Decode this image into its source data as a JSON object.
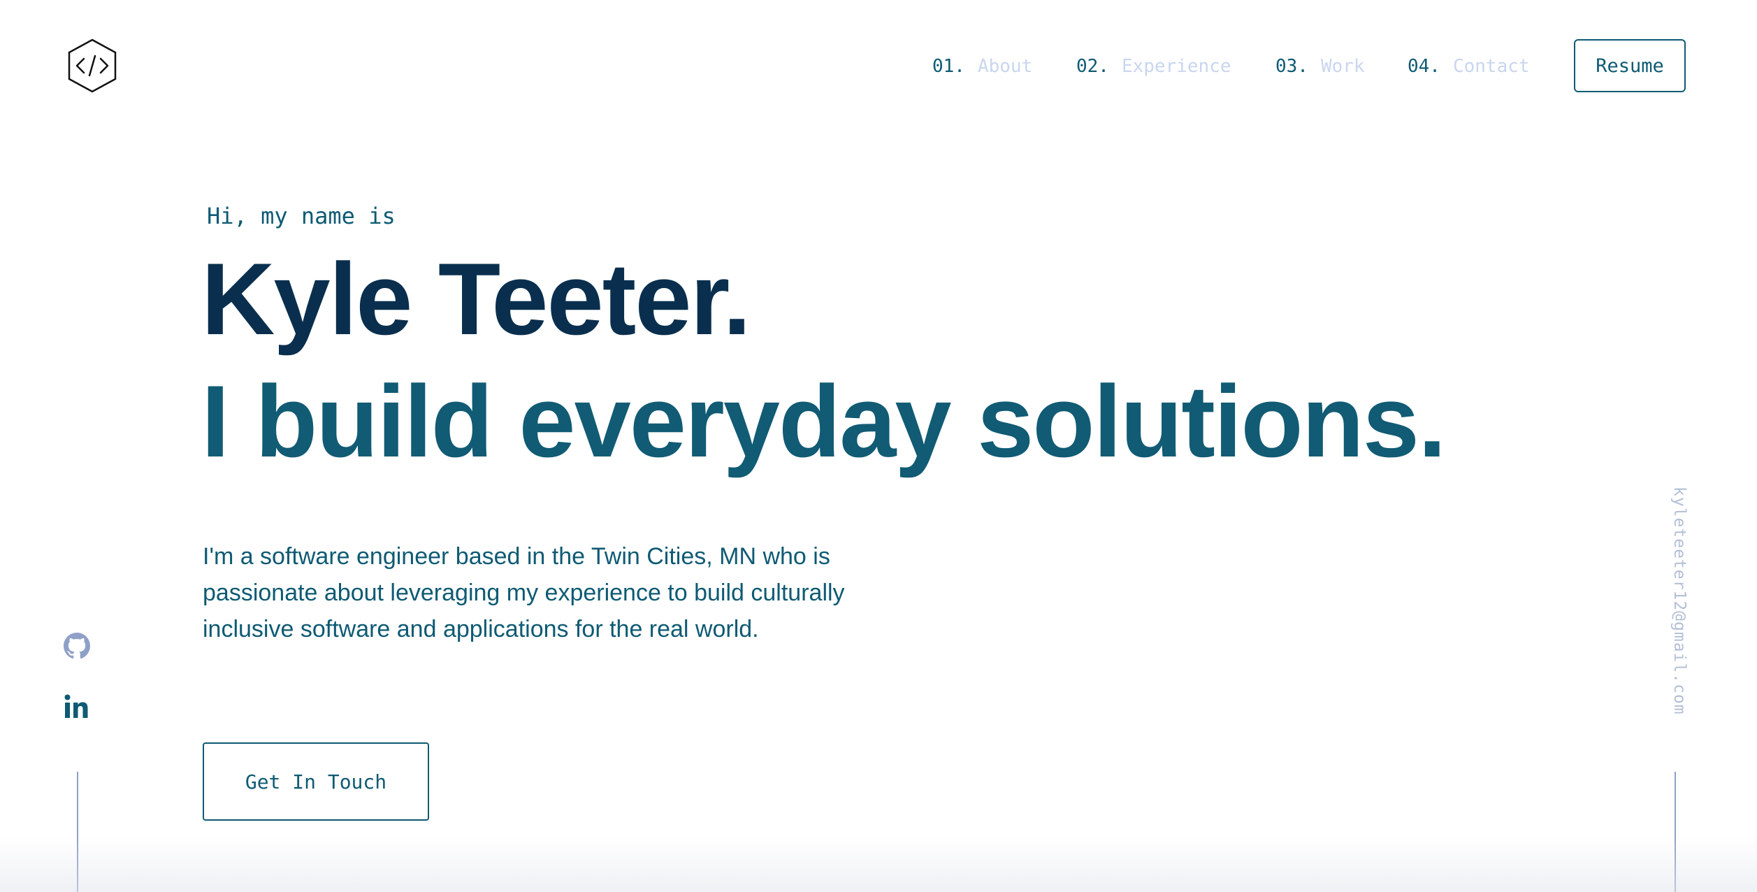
{
  "header": {
    "logo_icon": "code-hexagon-icon",
    "nav": [
      {
        "num": "01.",
        "label": "About"
      },
      {
        "num": "02.",
        "label": "Experience"
      },
      {
        "num": "03.",
        "label": "Work"
      },
      {
        "num": "04.",
        "label": "Contact"
      }
    ],
    "resume_label": "Resume"
  },
  "hero": {
    "greeting": "Hi, my name is",
    "name": "Kyle Teeter.",
    "tagline": "I build everyday solutions.",
    "bio": "I'm a software engineer based in the Twin Cities, MN who is passionate about leveraging my experience to build culturally inclusive software and applications for the real world.",
    "cta_label": "Get In Touch"
  },
  "socials": [
    {
      "icon": "github-icon"
    },
    {
      "icon": "linkedin-icon"
    }
  ],
  "email": "kyleteeter12@gmail.com",
  "colors": {
    "accent": "#0e5a73",
    "name": "#0a2f4e",
    "nav_label": "#c9d6ee",
    "email": "#b3bfd6",
    "line": "#8fa0c8"
  }
}
